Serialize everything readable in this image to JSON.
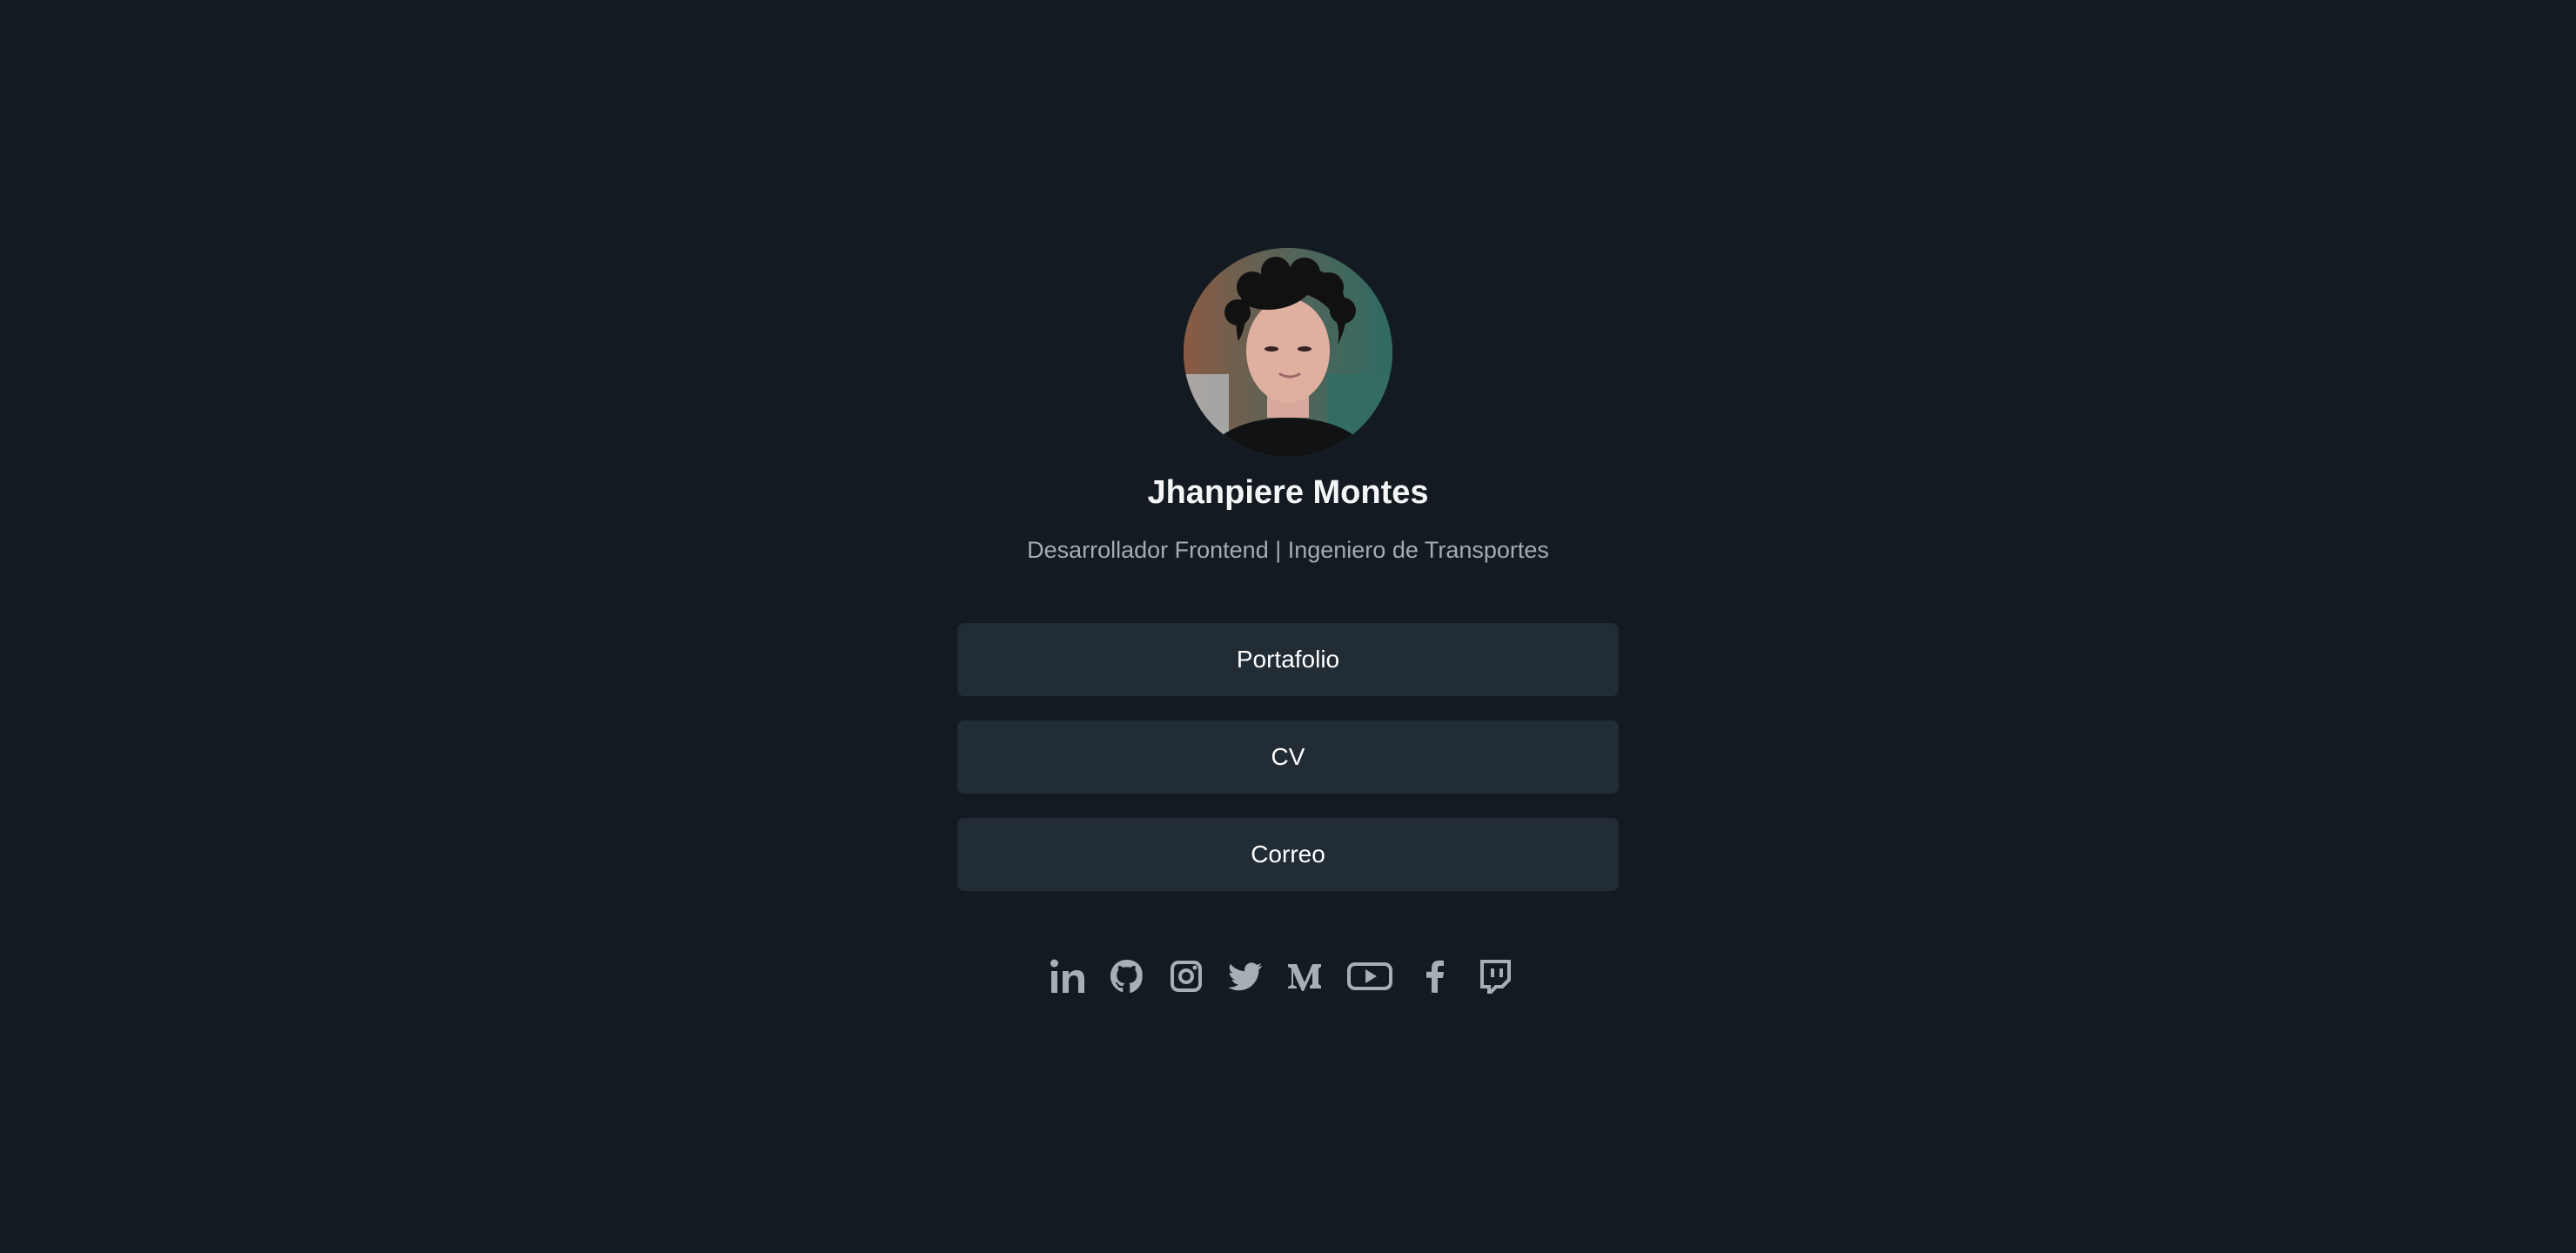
{
  "profile": {
    "name": "Jhanpiere Montes",
    "subtitle": "Desarrollador Frontend | Ingeniero de Transportes"
  },
  "links": [
    {
      "label": "Portafolio"
    },
    {
      "label": "CV"
    },
    {
      "label": "Correo"
    }
  ],
  "social": [
    {
      "icon": "linkedin-icon"
    },
    {
      "icon": "github-icon"
    },
    {
      "icon": "instagram-icon"
    },
    {
      "icon": "twitter-icon"
    },
    {
      "icon": "medium-icon"
    },
    {
      "icon": "youtube-icon"
    },
    {
      "icon": "facebook-icon"
    },
    {
      "icon": "twitch-icon"
    }
  ],
  "colors": {
    "background": "#131a21",
    "button": "#212c34",
    "text": "#ffffff",
    "muted": "#a3acb5",
    "icon": "#a7aeb5"
  }
}
